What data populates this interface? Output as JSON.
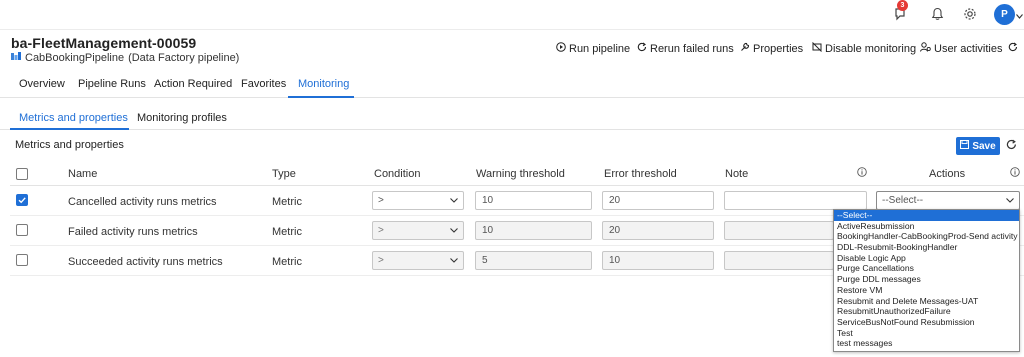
{
  "topbar": {
    "notifications_count": "3",
    "user_initial": "P"
  },
  "resource": {
    "title": "ba-FleetManagement-00059",
    "subtitle_name": "CabBookingPipeline",
    "subtitle_type": "(Data Factory pipeline)"
  },
  "actions": {
    "run": "Run pipeline",
    "rerun": "Rerun failed runs",
    "properties": "Properties",
    "disable": "Disable monitoring",
    "user_activities": "User activities"
  },
  "tabs": [
    "Overview",
    "Pipeline Runs",
    "Action Required",
    "Favorites",
    "Monitoring"
  ],
  "active_tab": "Monitoring",
  "subtabs": [
    "Metrics and properties",
    "Monitoring profiles"
  ],
  "active_subtab": "Metrics and properties",
  "section": {
    "title": "Metrics and properties",
    "save_label": "Save"
  },
  "table": {
    "headers": {
      "name": "Name",
      "type": "Type",
      "condition": "Condition",
      "warning": "Warning threshold",
      "error": "Error threshold",
      "note": "Note",
      "actions": "Actions"
    },
    "rows": [
      {
        "checked": true,
        "name": "Cancelled activity runs metrics",
        "type": "Metric",
        "condition": ">",
        "warning": "10",
        "error": "20",
        "note": "",
        "action": "--Select--"
      },
      {
        "checked": false,
        "name": "Failed activity runs metrics",
        "type": "Metric",
        "condition": ">",
        "warning": "10",
        "error": "20",
        "note": "",
        "action": ""
      },
      {
        "checked": false,
        "name": "Succeeded activity runs metrics",
        "type": "Metric",
        "condition": ">",
        "warning": "5",
        "error": "10",
        "note": "",
        "action": ""
      }
    ]
  },
  "actions_dropdown": {
    "options": [
      "--Select--",
      "ActiveResubmission",
      "BookingHandler-CabBookingProd-Send activity",
      "DDL-Resubmit-BookingHandler",
      "Disable Logic App",
      "Purge Cancellations",
      "Purge DDL messages",
      "Restore VM",
      "Resubmit and Delete Messages-UAT",
      "ResubmitUnauthorizedFailure",
      "ServiceBusNotFound Resubmission",
      "Test",
      "test messages"
    ],
    "highlighted": "--Select--"
  },
  "colors": {
    "accent": "#1f6fd6",
    "badge": "#e53935"
  },
  "icons": [
    "notification-alert-icon",
    "bell-icon",
    "gear-icon",
    "run-icon",
    "rerun-icon",
    "wrench-icon",
    "disable-monitor-icon",
    "user-activity-icon",
    "refresh-icon",
    "save-icon",
    "info-icon",
    "chevron-down-icon",
    "checkmark-icon",
    "pipeline-icon"
  ]
}
